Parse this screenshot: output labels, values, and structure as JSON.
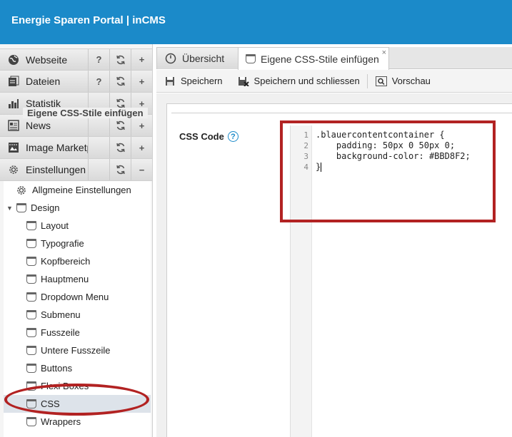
{
  "app": {
    "title": "Energie Sparen Portal | inCMS"
  },
  "sidebar": {
    "sections": [
      {
        "label": "Webseite",
        "icon": "globe-icon",
        "has_help": true,
        "action": "+"
      },
      {
        "label": "Dateien",
        "icon": "files-icon",
        "has_help": true,
        "action": "+"
      },
      {
        "label": "Statistik",
        "icon": "bar-chart-icon",
        "has_help": false,
        "action": "+"
      },
      {
        "label": "News",
        "icon": "news-icon",
        "has_help": false,
        "action": "+"
      },
      {
        "label": "Image Marketpl...",
        "icon": "image-market-icon",
        "has_help": false,
        "action": "+"
      },
      {
        "label": "Einstellungen",
        "icon": "gear-icon",
        "has_help": false,
        "action": "−"
      }
    ],
    "help_glyph": "?",
    "tree": [
      {
        "label": "Allgmeine Einstellungen",
        "icon": "gear-icon",
        "level": "root"
      },
      {
        "label": "Design",
        "icon": "paint-bucket-icon",
        "level": "root-expanded"
      },
      {
        "label": "Layout",
        "level": "child"
      },
      {
        "label": "Typografie",
        "level": "child"
      },
      {
        "label": "Kopfbereich",
        "level": "child"
      },
      {
        "label": "Hauptmenu",
        "level": "child"
      },
      {
        "label": "Dropdown Menu",
        "level": "child"
      },
      {
        "label": "Submenu",
        "level": "child"
      },
      {
        "label": "Fusszeile",
        "level": "child"
      },
      {
        "label": "Untere Fusszeile",
        "level": "child"
      },
      {
        "label": "Buttons",
        "level": "child"
      },
      {
        "label": "Flexi Boxes",
        "level": "child"
      },
      {
        "label": "CSS",
        "level": "child",
        "selected": true
      },
      {
        "label": "Wrappers",
        "level": "child"
      }
    ]
  },
  "tabs": [
    {
      "label": "Übersicht",
      "icon": "dashboard-icon",
      "active": false
    },
    {
      "label": "Eigene CSS-Stile einfügen",
      "icon": "paint-bucket-icon",
      "active": true,
      "close": "×"
    }
  ],
  "toolbar": {
    "save_label": "Speichern",
    "save_close_label": "Speichern und schliessen",
    "preview_label": "Vorschau"
  },
  "form": {
    "legend": "Eigene CSS-Stile einfügen",
    "css_label": "CSS Code",
    "help_glyph": "?"
  },
  "editor": {
    "line_numbers": [
      "1",
      "2",
      "3",
      "4"
    ],
    "lines": [
      ".blauercontentcontainer {",
      "    padding: 50px 0 50px 0;",
      "    background-color: #BBD8F2;",
      "}"
    ]
  },
  "colors": {
    "header_bg": "#1b8ac9",
    "annotation_red": "#b22222",
    "hex_value": "#1a1aa6"
  }
}
